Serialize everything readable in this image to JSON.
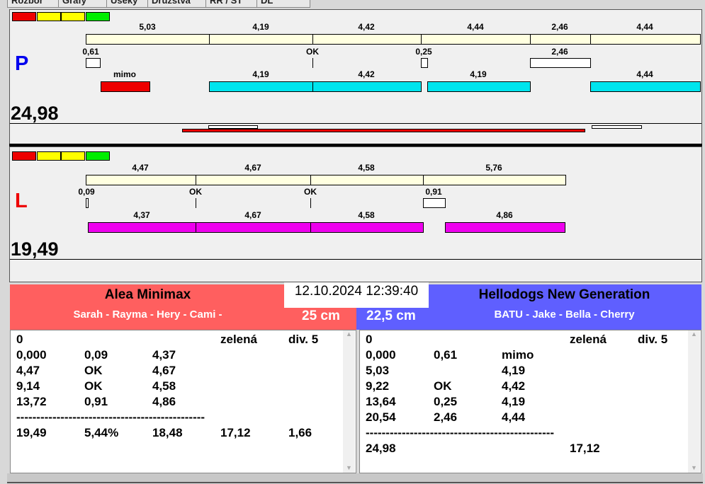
{
  "tabs": [
    "Rozbor",
    "Grafy",
    "Úseky",
    "Družstvá",
    "RR / ST",
    "DL"
  ],
  "colors": {
    "red": "#ee0000",
    "yellow": "#ffff00",
    "green": "#00ee00",
    "cream": "#ffffe0",
    "cyan": "#00e5ee",
    "magenta": "#ee00ee",
    "teamA": "#ff5f5f",
    "teamB": "#5f5fff"
  },
  "p": {
    "letter": "P",
    "total": "24,98",
    "row1": [
      "5,03",
      "4,19",
      "4,42",
      "4,44",
      "2,46",
      "4,44"
    ],
    "row2": [
      "0,61",
      "OK",
      "0,25",
      "2,46"
    ],
    "row3": [
      "mimo",
      "4,19",
      "4,42",
      "4,19",
      "4,44"
    ]
  },
  "l": {
    "letter": "L",
    "total": "19,49",
    "row1": [
      "4,47",
      "4,67",
      "4,58",
      "5,76"
    ],
    "row2": [
      "0,09",
      "OK",
      "OK",
      "0,91"
    ],
    "row3": [
      "4,37",
      "4,67",
      "4,58",
      "4,86"
    ]
  },
  "datetime": "12.10.2024 12:39:40",
  "teamA": {
    "name": "Alea Minimax",
    "dogs": "Sarah - Rayma - Hery - Cami -",
    "height": "25 cm",
    "rows": [
      [
        "0",
        "",
        "",
        "zelená",
        "div. 5"
      ],
      [
        "0,000",
        "0,09",
        "4,37",
        "",
        ""
      ],
      [
        "4,47",
        "OK",
        "4,67",
        "",
        ""
      ],
      [
        "9,14",
        "OK",
        "4,58",
        "",
        ""
      ],
      [
        "13,72",
        "0,91",
        "4,86",
        "",
        ""
      ],
      [
        "-----------------------------------------------",
        "",
        "",
        "",
        ""
      ],
      [
        "19,49",
        "5,44%",
        "18,48",
        "17,12",
        "1,66"
      ]
    ]
  },
  "teamB": {
    "name": "Hellodogs New Generation",
    "dogs": "BATU - Jake - Bella - Cherry",
    "height": "22,5 cm",
    "rows": [
      [
        "0",
        "",
        "",
        "zelená",
        "div. 5"
      ],
      [
        "0,000",
        "0,61",
        "mimo",
        "",
        ""
      ],
      [
        "5,03",
        "",
        "4,19",
        "",
        ""
      ],
      [
        "9,22",
        "OK",
        "4,42",
        "",
        ""
      ],
      [
        "13,64",
        "0,25",
        "4,19",
        "",
        ""
      ],
      [
        "20,54",
        "2,46",
        "4,44",
        "",
        ""
      ],
      [
        "-----------------------------------------------",
        "",
        "",
        "",
        ""
      ],
      [
        "24,98",
        "",
        "",
        "17,12",
        ""
      ]
    ]
  }
}
